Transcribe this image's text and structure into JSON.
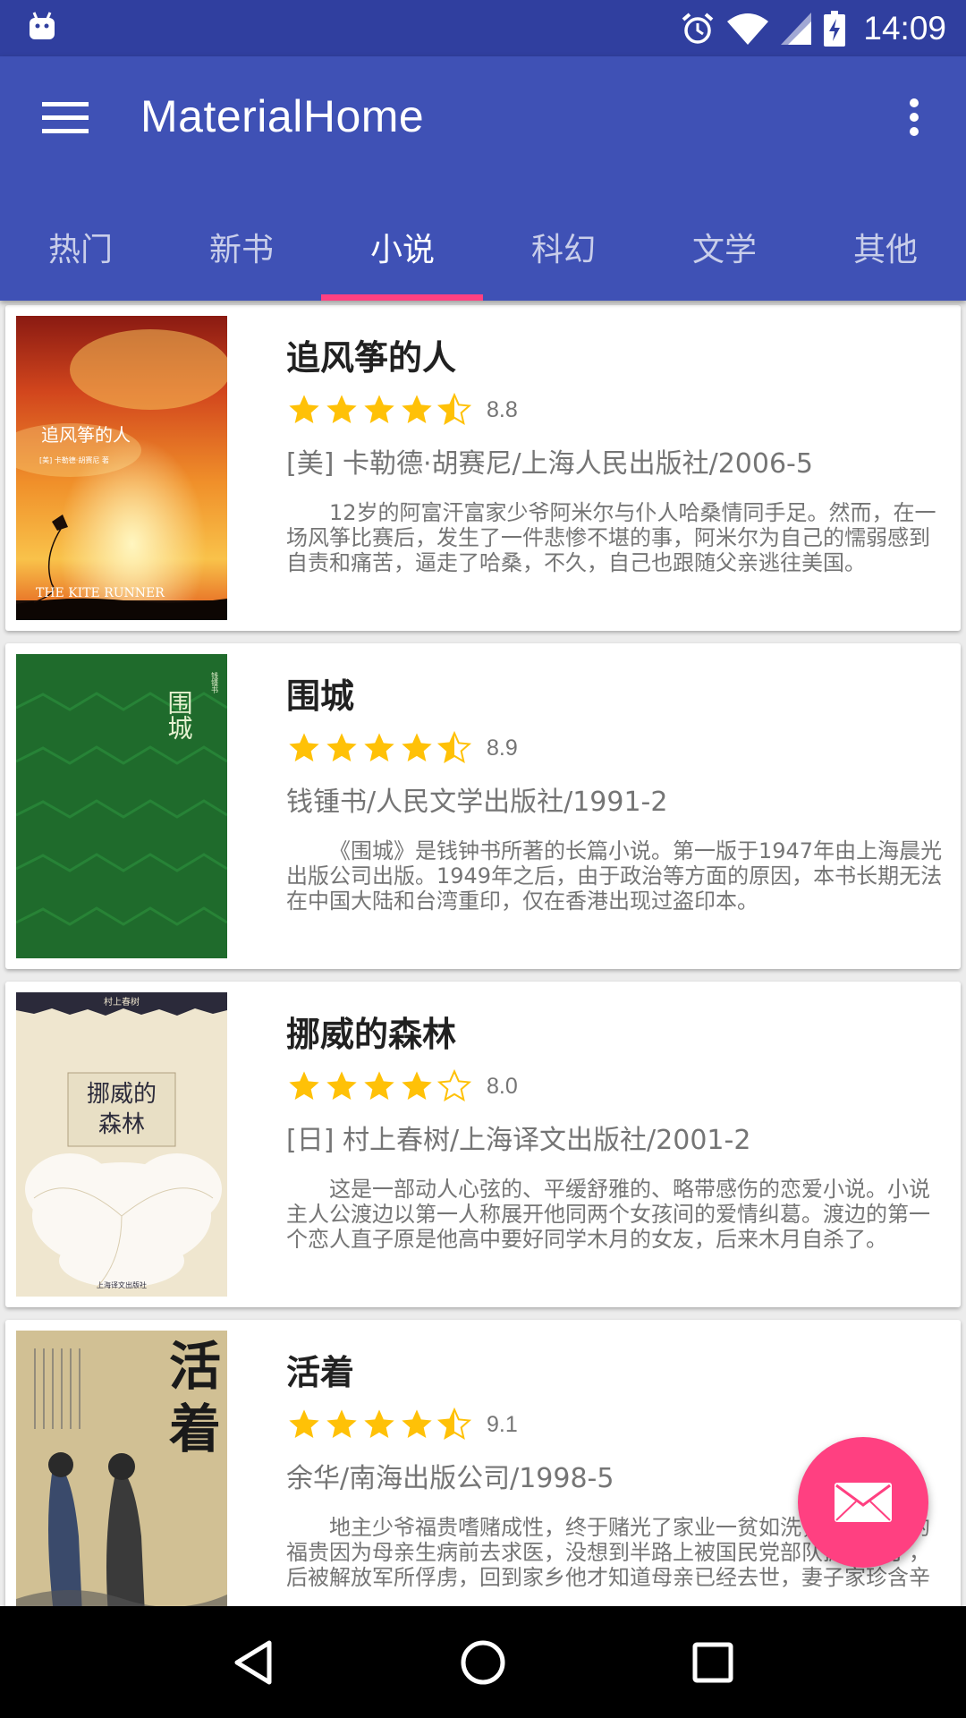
{
  "status_bar": {
    "time": "14:09",
    "icons": [
      "android-icon",
      "alarm-icon",
      "wifi-icon",
      "signal-icon",
      "battery-charging-icon"
    ]
  },
  "app_bar": {
    "title": "MaterialHome",
    "menu_icon": "hamburger-menu-icon",
    "overflow_icon": "more-vert-icon"
  },
  "tabs": [
    {
      "label": "热门"
    },
    {
      "label": "新书"
    },
    {
      "label": "小说",
      "active": true
    },
    {
      "label": "科幻"
    },
    {
      "label": "文学"
    },
    {
      "label": "其他"
    }
  ],
  "books": [
    {
      "title": "追风筝的人",
      "rating": "8.8",
      "stars": 4.5,
      "info": "[美] 卡勒德·胡赛尼/上海人民出版社/2006-5",
      "summary": "12岁的阿富汗富家少爷阿米尔与仆人哈桑情同手足。然而，在一场风筝比赛后，发生了一件悲惨不堪的事，阿米尔为自己的懦弱感到自责和痛苦，逼走了哈桑，不久，自己也跟随父亲逃往美国。",
      "cover": {
        "title": "追风筝的人",
        "subtitle": "THE KITE RUNNER",
        "author_line": "[美] 卡勒德·胡赛尼 著"
      }
    },
    {
      "title": "围城",
      "rating": "8.9",
      "stars": 4.5,
      "info": "钱锺书/人民文学出版社/1991-2",
      "summary": "《围城》是钱钟书所著的长篇小说。第一版于1947年由上海晨光出版公司出版。1949年之后，由于政治等方面的原因，本书长期无法在中国大陆和台湾重印，仅在香港出现过盗印本。",
      "cover": {
        "title": "围城"
      }
    },
    {
      "title": "挪威的森林",
      "rating": "8.0",
      "stars": 4,
      "info": "[日] 村上春树/上海译文出版社/2001-2",
      "summary": "这是一部动人心弦的、平缓舒雅的、略带感伤的恋爱小说。小说主人公渡边以第一人称展开他同两个女孩间的爱情纠葛。渡边的第一个恋人直子原是他高中要好同学木月的女友，后来木月自杀了。",
      "cover": {
        "title": "挪威的森林",
        "author": "村上春树",
        "publisher": "上海译文出版社"
      }
    },
    {
      "title": "活着",
      "rating": "9.1",
      "stars": 4.5,
      "info": "余华/南海出版公司/1998-5",
      "summary": "地主少爷福贵嗜赌成性，终于赌光了家业一贫如洗，穷困之中的福贵因为母亲生病前去求医，没想到半路上被国民党部队抓了壮丁，后被解放军所俘虏，回到家乡他才知道母亲已经去世，妻子家珍含辛茹苦带大了一双儿女。",
      "cover": {
        "title": "活着"
      }
    }
  ],
  "fab": {
    "icon": "mail-icon"
  },
  "nav_bar": {
    "icons": [
      "back-icon",
      "home-icon",
      "recents-icon"
    ]
  },
  "colors": {
    "primary": "#3F51B5",
    "primary_dark": "#303F9F",
    "accent": "#FF4081",
    "star": "#FFC107"
  }
}
